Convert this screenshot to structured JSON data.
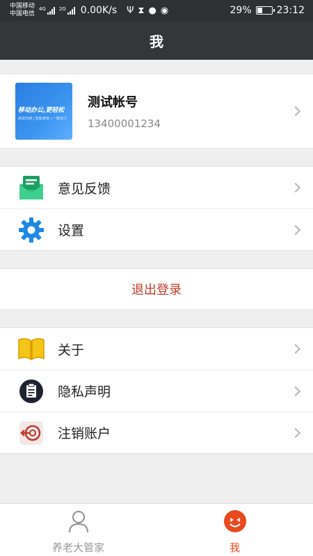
{
  "status_bar": {
    "carrier1": "中国移动",
    "carrier2": "中国电信",
    "net1": "4G",
    "net2": "2G",
    "speed": "0.00K/s",
    "battery": "29%",
    "time": "23:12"
  },
  "header": {
    "title": "我"
  },
  "profile": {
    "avatar_line1": "移动办公,更轻松",
    "avatar_line2": "高效沟通 | 智能审批 | 一键支付",
    "name": "测试帐号",
    "phone": "13400001234"
  },
  "menu1": [
    {
      "label": "意见反馈",
      "icon": "feedback-mail-icon"
    },
    {
      "label": "设置",
      "icon": "gear-icon"
    }
  ],
  "logout_label": "退出登录",
  "menu2": [
    {
      "label": "关于",
      "icon": "book-icon"
    },
    {
      "label": "隐私声明",
      "icon": "privacy-clipboard-icon"
    },
    {
      "label": "注销账户",
      "icon": "logout-arrow-icon"
    }
  ],
  "tabs": [
    {
      "label": "养老大管家",
      "icon": "person-icon",
      "active": false
    },
    {
      "label": "我",
      "icon": "smiley-icon",
      "active": true
    }
  ],
  "colors": {
    "header_bg": "#353637",
    "logout_text": "#c0392b",
    "tab_active": "#e8491f",
    "feedback_icon": "#2ec27e",
    "settings_icon": "#1e88e5",
    "about_icon": "#f5c518"
  }
}
